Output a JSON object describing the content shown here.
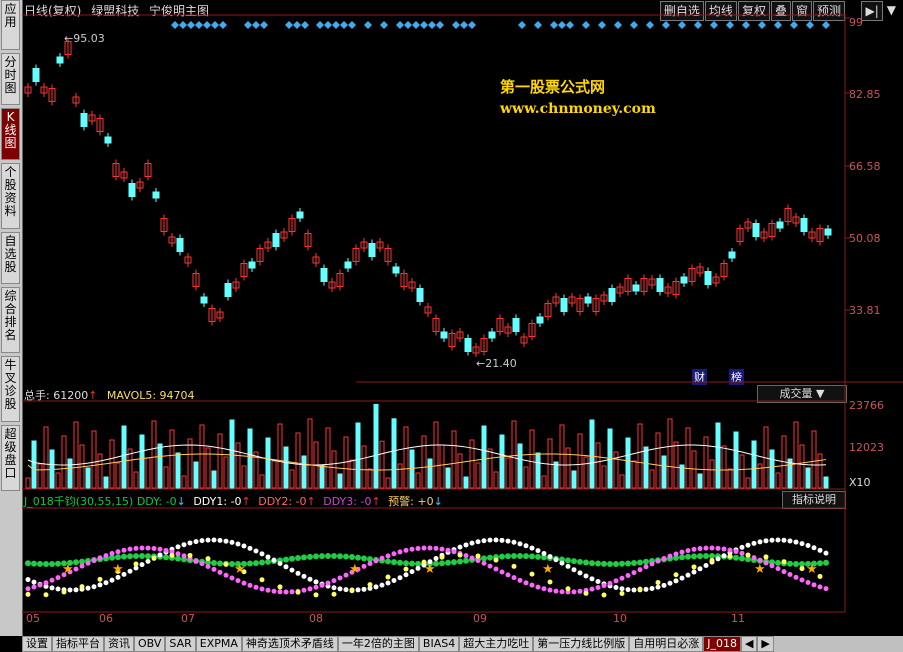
{
  "sidebar": {
    "tabs": [
      {
        "label": "应用",
        "active": false
      },
      {
        "label": "分时图",
        "active": false
      },
      {
        "label": "K线图",
        "active": true
      },
      {
        "label": "个股资料",
        "active": false
      },
      {
        "label": "自选股",
        "active": false
      },
      {
        "label": "综合排名",
        "active": false
      },
      {
        "label": "牛叉诊股",
        "active": false
      },
      {
        "label": "超级盘口",
        "active": false
      }
    ]
  },
  "header": {
    "period": "日线(复权)",
    "stock": "绿盟科技",
    "indicator": "宁俊明主图"
  },
  "toolbar": {
    "buttons": [
      "删自选",
      "均线",
      "复权",
      "叠",
      "窗",
      "预测"
    ],
    "corner": "99"
  },
  "watermark": {
    "line1": "第一股票公式网",
    "line2": "www.chnmoney.com"
  },
  "price_axis": [
    "82.85",
    "66.58",
    "50.08",
    "33.81"
  ],
  "annotations": {
    "high": "←95.03",
    "low": "←21.40",
    "badge1": "财",
    "badge2": "榜"
  },
  "volume": {
    "label": "总手: 61200",
    "ma_label": "MAVOL5: 94704",
    "selector": "成交量",
    "axis": [
      "23766",
      "12023",
      "X10"
    ]
  },
  "indicator": {
    "name": "J_018千钧(30,55,15)",
    "ddy": "DDY: -0",
    "ddy1": "DDY1: -0",
    "ddy2": "DDY2: -0",
    "ddy3": "DDY3: -0",
    "warn": "预警: +0",
    "button": "指标说明",
    "colors": {
      "ddy": "#00cc44",
      "ddy1": "#ffffff",
      "ddy2": "#ff6666",
      "ddy3": "#cc44cc",
      "warn": "#ffcc66"
    }
  },
  "dates": [
    "05",
    "06",
    "07",
    "08",
    "09",
    "10",
    "11"
  ],
  "bottom_tabs": [
    "设置",
    "指标平台",
    "资讯",
    "OBV",
    "SAR",
    "EXPMA",
    "神奇选顶术矛盾线",
    "一年2倍的主图",
    "BIAS4",
    "超大主力吃吐",
    "第一压力线比例版",
    "自用明日必涨",
    "J_018"
  ]
}
